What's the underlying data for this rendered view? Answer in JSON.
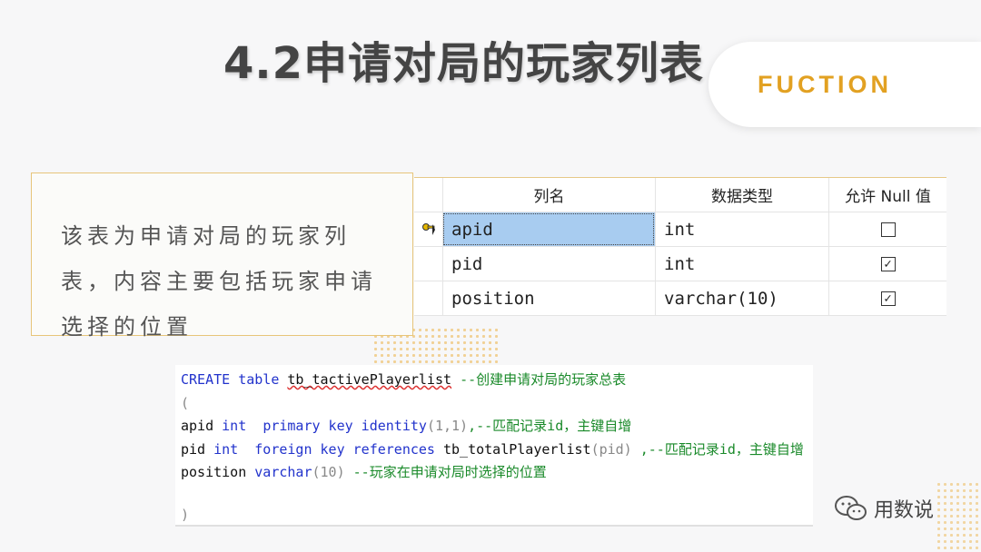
{
  "slide": {
    "title": "4.2申请对局的玩家列表",
    "tag": "FUCTION",
    "description": "该表为申请对局的玩家列表，内容主要包括玩家申请选择的位置"
  },
  "table": {
    "headers": [
      "列名",
      "数据类型",
      "允许 Null 值"
    ],
    "rows": [
      {
        "name": "apid",
        "type": "int",
        "nullable": false,
        "key": true,
        "selected": true
      },
      {
        "name": "pid",
        "type": "int",
        "nullable": true,
        "key": false,
        "selected": false
      },
      {
        "name": "position",
        "type": "varchar(10)",
        "nullable": true,
        "key": false,
        "selected": false
      }
    ],
    "check_mark": "✓"
  },
  "code": {
    "line1": {
      "kw1": "CREATE",
      "kw2": "table",
      "ident": "tb_tactivePlayerlist",
      "comment": "--创建申请对局的玩家总表"
    },
    "line2": {
      "paren": "("
    },
    "line3": {
      "col": "apid",
      "type": "int",
      "kw": "primary key identity",
      "args": "(1,1)",
      "comment": ",--匹配记录id，主键自增"
    },
    "line4": {
      "col": "pid",
      "type": "int",
      "kw": "foreign key references",
      "ref": "tb_totalPlayerlist",
      "args": "(pid)",
      "comment": " ,--匹配记录id，主键自增"
    },
    "line5": {
      "col": "position",
      "type": "varchar",
      "args": "(10)",
      "comment": "--玩家在申请对局时选择的位置"
    },
    "close": ")"
  },
  "brand": {
    "text": "用数说",
    "icon": "wechat-icon"
  },
  "colors": {
    "accent": "#e2a122",
    "selection": "#a8ccf0",
    "keyword": "#2233cc",
    "comment": "#1a8a2a"
  }
}
